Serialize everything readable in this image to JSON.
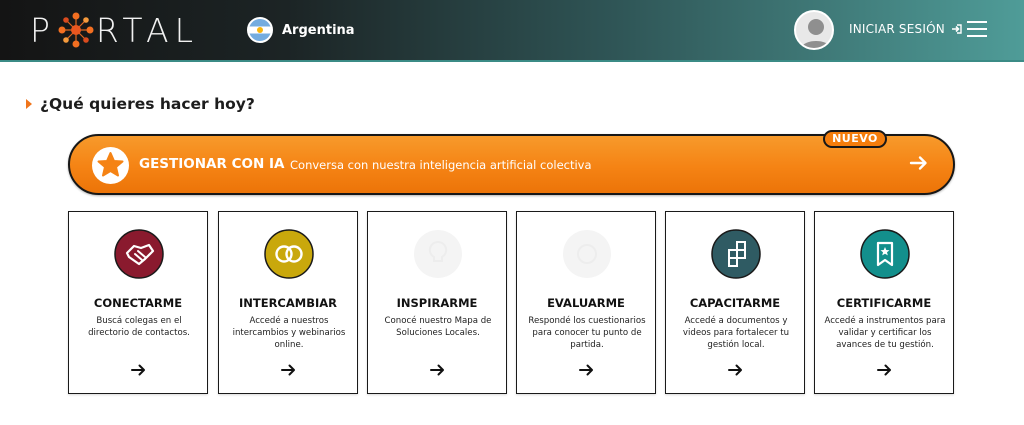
{
  "header": {
    "logo_text_left": "P",
    "logo_text_right": "RTAL",
    "country": "Argentina",
    "login_label": "INICIAR SESIÓN",
    "menu_icon": "hamburger-icon"
  },
  "main": {
    "question": "¿Qué quieres hacer hoy?"
  },
  "ia": {
    "badge": "NUEVO",
    "title": "GESTIONAR CON IA",
    "description": "Conversa con nuestra inteligencia artificial colectiva"
  },
  "colors": {
    "accent": "#f58314",
    "brand_teal": "#4f9c98"
  },
  "cards": [
    {
      "title": "CONECTARME",
      "description": "Buscá colegas en el directorio de contactos.",
      "icon": "handshake-icon",
      "color": "#8a1a2e"
    },
    {
      "title": "INTERCAMBIAR",
      "description": "Accedé a nuestros intercambios y webinarios online.",
      "icon": "linked-rings-icon",
      "color": "#c9a80c"
    },
    {
      "title": "INSPIRARME",
      "description": "Conocé nuestro Mapa de Soluciones Locales.",
      "icon": "lightbulb-icon",
      "color": "#f4f4f4"
    },
    {
      "title": "EVALUARME",
      "description": "Respondé los cuestionarios para conocer tu punto de partida.",
      "icon": "checklist-icon",
      "color": "#f4f4f4"
    },
    {
      "title": "CAPACITARME",
      "description": "Accedé a documentos y videos para fortalecer tu gestión local.",
      "icon": "blocks-icon",
      "color": "#2f5b63"
    },
    {
      "title": "CERTIFICARME",
      "description": "Accedé a instrumentos para validar y certificar los avances de tu gestión.",
      "icon": "certificate-icon",
      "color": "#138f8c"
    }
  ]
}
